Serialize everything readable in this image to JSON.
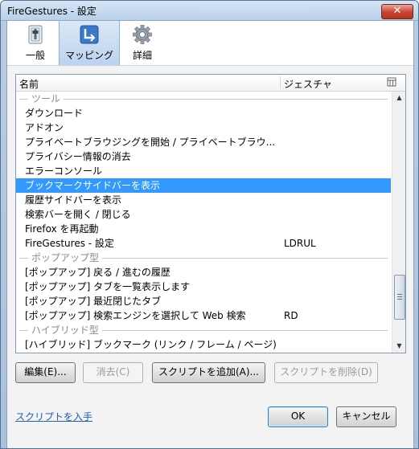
{
  "window": {
    "title": "FireGestures - 設定",
    "close_glyph": "✕"
  },
  "toolbar": {
    "tabs": [
      {
        "label": "一般",
        "icon": "switch-icon"
      },
      {
        "label": "マッピング",
        "icon": "mapping-arrow-icon",
        "active": true
      },
      {
        "label": "詳細",
        "icon": "gear-icon"
      }
    ]
  },
  "list": {
    "columns": {
      "name": "名前",
      "gesture": "ジェスチャ"
    },
    "rows": [
      {
        "type": "separator",
        "name": "ツール"
      },
      {
        "type": "item",
        "name": "ダウンロード",
        "gesture": ""
      },
      {
        "type": "item",
        "name": "アドオン",
        "gesture": ""
      },
      {
        "type": "item",
        "name": "プライベートブラウジングを開始 / プライベートブラウ...",
        "gesture": ""
      },
      {
        "type": "item",
        "name": "プライバシー情報の消去",
        "gesture": ""
      },
      {
        "type": "item",
        "name": "エラーコンソール",
        "gesture": ""
      },
      {
        "type": "item",
        "name": "ブックマークサイドバーを表示",
        "gesture": "",
        "selected": true
      },
      {
        "type": "item",
        "name": "履歴サイドバーを表示",
        "gesture": ""
      },
      {
        "type": "item",
        "name": "検索バーを開く / 閉じる",
        "gesture": ""
      },
      {
        "type": "item",
        "name": "Firefox を再起動",
        "gesture": ""
      },
      {
        "type": "item",
        "name": "FireGestures - 設定",
        "gesture": "LDRUL"
      },
      {
        "type": "separator",
        "name": "ポップアップ型"
      },
      {
        "type": "item",
        "name": "[ポップアップ] 戻る / 進むの履歴",
        "gesture": ""
      },
      {
        "type": "item",
        "name": "[ポップアップ] タブを一覧表示します",
        "gesture": ""
      },
      {
        "type": "item",
        "name": "[ポップアップ] 最近閉じたタブ",
        "gesture": ""
      },
      {
        "type": "item",
        "name": "[ポップアップ] 検索エンジンを選択して Web 検索",
        "gesture": "RD"
      },
      {
        "type": "separator",
        "name": "ハイブリッド型"
      },
      {
        "type": "item",
        "name": "[ハイブリッド] ブックマーク (リンク / フレーム / ページ)",
        "gesture": ""
      }
    ]
  },
  "buttons": {
    "edit": "編集(E)...",
    "clear": "消去(C)",
    "add_script": "スクリプトを追加(A)...",
    "delete_script": "スクリプトを削除(D)",
    "ok": "OK",
    "cancel": "キャンセル"
  },
  "link": {
    "get_scripts": "スクリプトを入手"
  },
  "colors": {
    "selection": "#3399ff",
    "link": "#1f5fb5",
    "close": "#c8432f"
  }
}
